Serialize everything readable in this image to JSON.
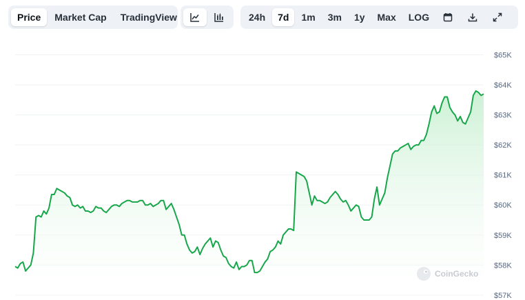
{
  "toolbar": {
    "main_tabs": [
      "Price",
      "Market Cap",
      "TradingView"
    ],
    "active_main": "Price",
    "view_icons": [
      "line-chart-icon",
      "candlestick-icon"
    ],
    "ranges": [
      "24h",
      "7d",
      "1m",
      "3m",
      "1y",
      "Max",
      "LOG"
    ],
    "active_range": "7d",
    "tool_icons": [
      "calendar-icon",
      "download-icon",
      "expand-icon"
    ]
  },
  "watermark": {
    "text": "CoinGecko"
  },
  "colors": {
    "line": "#16c784",
    "line_dark": "#17a64a",
    "fill_top": "#c9f0d2",
    "grid": "#eff2f5",
    "active_bg": "#ffffff",
    "segment_bg": "#eef1f5"
  },
  "chart_data": {
    "type": "area",
    "title": "",
    "xlabel": "",
    "ylabel": "",
    "ylim": [
      56950,
      65450
    ],
    "yticks": [
      57000,
      58000,
      59000,
      60000,
      61000,
      62000,
      63000,
      64000,
      65000
    ],
    "ytick_labels": [
      "$57K",
      "$58K",
      "$59K",
      "$60K",
      "$61K",
      "$62K",
      "$63K",
      "$64K",
      "$65K"
    ],
    "grid": true,
    "series": [
      {
        "values": [
          57950,
          57900,
          58050,
          58100,
          57800,
          57900,
          58000,
          58400,
          59600,
          59650,
          59600,
          59800,
          59700,
          59900,
          60350,
          60350,
          60550,
          60500,
          60450,
          60400,
          60300,
          60250,
          60000,
          59950,
          60000,
          59900,
          59950,
          59800,
          59800,
          59750,
          59800,
          59950,
          59900,
          59900,
          59800,
          59750,
          59850,
          59950,
          60000,
          60000,
          59950,
          60050,
          60100,
          60150,
          60150,
          60100,
          60100,
          60100,
          60150,
          60150,
          60000,
          60000,
          60050,
          59950,
          60000,
          60050,
          60150,
          60150,
          59850,
          59950,
          60050,
          59850,
          59600,
          59350,
          59000,
          59000,
          58700,
          58500,
          58400,
          58450,
          58600,
          58350,
          58550,
          58700,
          58800,
          58900,
          58600,
          58800,
          58750,
          58500,
          58300,
          58250,
          58050,
          57950,
          57900,
          58100,
          57850,
          57950,
          57950,
          58000,
          58150,
          58150,
          57750,
          57750,
          57800,
          57950,
          58100,
          58200,
          58450,
          58500,
          58600,
          58800,
          58700,
          59000,
          59100,
          59200,
          59200,
          59150,
          61100,
          61050,
          61000,
          60950,
          60800,
          60400,
          60000,
          60300,
          60150,
          60150,
          60100,
          60050,
          60100,
          60250,
          60350,
          60450,
          60350,
          60200,
          60100,
          60150,
          60000,
          59800,
          59900,
          60000,
          59950,
          59600,
          59500,
          59500,
          59500,
          59600,
          60200,
          60600,
          60000,
          60200,
          60400,
          60900,
          61300,
          61700,
          61800,
          61800,
          61900,
          61950,
          62000,
          62050,
          61850,
          61950,
          62000,
          62000,
          62150,
          62150,
          62350,
          62700,
          63100,
          63300,
          63050,
          63100,
          63400,
          63600,
          63600,
          63250,
          63100,
          63000,
          62800,
          62950,
          62750,
          62700,
          62900,
          63100,
          63650,
          63800,
          63750,
          63650,
          63700
        ]
      }
    ]
  }
}
